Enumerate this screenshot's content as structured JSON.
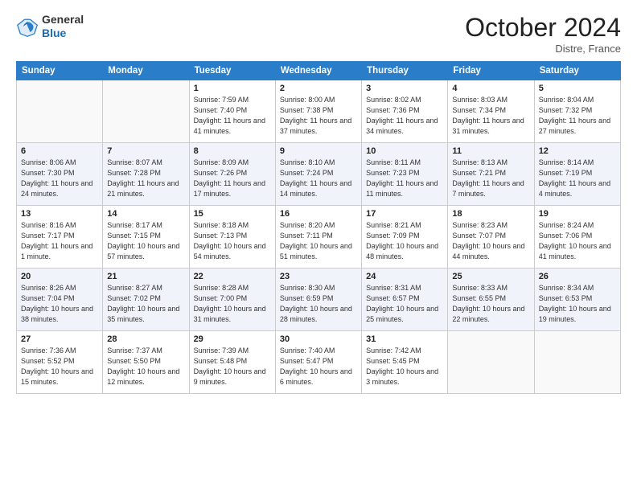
{
  "header": {
    "logo_line1": "General",
    "logo_line2": "Blue",
    "month_title": "October 2024",
    "location": "Distre, France"
  },
  "days_of_week": [
    "Sunday",
    "Monday",
    "Tuesday",
    "Wednesday",
    "Thursday",
    "Friday",
    "Saturday"
  ],
  "weeks": [
    [
      {
        "day": "",
        "info": ""
      },
      {
        "day": "",
        "info": ""
      },
      {
        "day": "1",
        "info": "Sunrise: 7:59 AM\nSunset: 7:40 PM\nDaylight: 11 hours and 41 minutes."
      },
      {
        "day": "2",
        "info": "Sunrise: 8:00 AM\nSunset: 7:38 PM\nDaylight: 11 hours and 37 minutes."
      },
      {
        "day": "3",
        "info": "Sunrise: 8:02 AM\nSunset: 7:36 PM\nDaylight: 11 hours and 34 minutes."
      },
      {
        "day": "4",
        "info": "Sunrise: 8:03 AM\nSunset: 7:34 PM\nDaylight: 11 hours and 31 minutes."
      },
      {
        "day": "5",
        "info": "Sunrise: 8:04 AM\nSunset: 7:32 PM\nDaylight: 11 hours and 27 minutes."
      }
    ],
    [
      {
        "day": "6",
        "info": "Sunrise: 8:06 AM\nSunset: 7:30 PM\nDaylight: 11 hours and 24 minutes."
      },
      {
        "day": "7",
        "info": "Sunrise: 8:07 AM\nSunset: 7:28 PM\nDaylight: 11 hours and 21 minutes."
      },
      {
        "day": "8",
        "info": "Sunrise: 8:09 AM\nSunset: 7:26 PM\nDaylight: 11 hours and 17 minutes."
      },
      {
        "day": "9",
        "info": "Sunrise: 8:10 AM\nSunset: 7:24 PM\nDaylight: 11 hours and 14 minutes."
      },
      {
        "day": "10",
        "info": "Sunrise: 8:11 AM\nSunset: 7:23 PM\nDaylight: 11 hours and 11 minutes."
      },
      {
        "day": "11",
        "info": "Sunrise: 8:13 AM\nSunset: 7:21 PM\nDaylight: 11 hours and 7 minutes."
      },
      {
        "day": "12",
        "info": "Sunrise: 8:14 AM\nSunset: 7:19 PM\nDaylight: 11 hours and 4 minutes."
      }
    ],
    [
      {
        "day": "13",
        "info": "Sunrise: 8:16 AM\nSunset: 7:17 PM\nDaylight: 11 hours and 1 minute."
      },
      {
        "day": "14",
        "info": "Sunrise: 8:17 AM\nSunset: 7:15 PM\nDaylight: 10 hours and 57 minutes."
      },
      {
        "day": "15",
        "info": "Sunrise: 8:18 AM\nSunset: 7:13 PM\nDaylight: 10 hours and 54 minutes."
      },
      {
        "day": "16",
        "info": "Sunrise: 8:20 AM\nSunset: 7:11 PM\nDaylight: 10 hours and 51 minutes."
      },
      {
        "day": "17",
        "info": "Sunrise: 8:21 AM\nSunset: 7:09 PM\nDaylight: 10 hours and 48 minutes."
      },
      {
        "day": "18",
        "info": "Sunrise: 8:23 AM\nSunset: 7:07 PM\nDaylight: 10 hours and 44 minutes."
      },
      {
        "day": "19",
        "info": "Sunrise: 8:24 AM\nSunset: 7:06 PM\nDaylight: 10 hours and 41 minutes."
      }
    ],
    [
      {
        "day": "20",
        "info": "Sunrise: 8:26 AM\nSunset: 7:04 PM\nDaylight: 10 hours and 38 minutes."
      },
      {
        "day": "21",
        "info": "Sunrise: 8:27 AM\nSunset: 7:02 PM\nDaylight: 10 hours and 35 minutes."
      },
      {
        "day": "22",
        "info": "Sunrise: 8:28 AM\nSunset: 7:00 PM\nDaylight: 10 hours and 31 minutes."
      },
      {
        "day": "23",
        "info": "Sunrise: 8:30 AM\nSunset: 6:59 PM\nDaylight: 10 hours and 28 minutes."
      },
      {
        "day": "24",
        "info": "Sunrise: 8:31 AM\nSunset: 6:57 PM\nDaylight: 10 hours and 25 minutes."
      },
      {
        "day": "25",
        "info": "Sunrise: 8:33 AM\nSunset: 6:55 PM\nDaylight: 10 hours and 22 minutes."
      },
      {
        "day": "26",
        "info": "Sunrise: 8:34 AM\nSunset: 6:53 PM\nDaylight: 10 hours and 19 minutes."
      }
    ],
    [
      {
        "day": "27",
        "info": "Sunrise: 7:36 AM\nSunset: 5:52 PM\nDaylight: 10 hours and 15 minutes."
      },
      {
        "day": "28",
        "info": "Sunrise: 7:37 AM\nSunset: 5:50 PM\nDaylight: 10 hours and 12 minutes."
      },
      {
        "day": "29",
        "info": "Sunrise: 7:39 AM\nSunset: 5:48 PM\nDaylight: 10 hours and 9 minutes."
      },
      {
        "day": "30",
        "info": "Sunrise: 7:40 AM\nSunset: 5:47 PM\nDaylight: 10 hours and 6 minutes."
      },
      {
        "day": "31",
        "info": "Sunrise: 7:42 AM\nSunset: 5:45 PM\nDaylight: 10 hours and 3 minutes."
      },
      {
        "day": "",
        "info": ""
      },
      {
        "day": "",
        "info": ""
      }
    ]
  ]
}
